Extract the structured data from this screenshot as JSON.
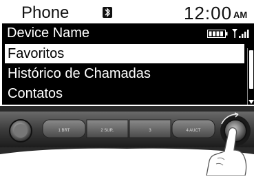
{
  "header": {
    "title": "Phone",
    "bluetooth_icon": "bluetooth-icon",
    "time": "12:00",
    "ampm": "AM"
  },
  "device": {
    "name": "Device Name",
    "battery_icon": "battery-icon",
    "signal_icon": "signal-strength-icon"
  },
  "menu": {
    "items": [
      {
        "label": "Favoritos",
        "selected": true
      },
      {
        "label": "Histórico de Chamadas",
        "selected": false
      },
      {
        "label": "Contatos",
        "selected": false
      }
    ]
  },
  "scrollbar": {
    "visible_fraction": 0.7
  },
  "controls": {
    "buttons": [
      "1 BRT",
      "2 SUR.",
      "3",
      "4 AUCT"
    ],
    "knob_left_icon": "volume-knob-icon",
    "knob_right_icon": "tune-knob-icon",
    "hand_icon": "pointing-hand-icon"
  },
  "colors": {
    "screen_bg": "#000000",
    "highlight": "#ffffff"
  }
}
